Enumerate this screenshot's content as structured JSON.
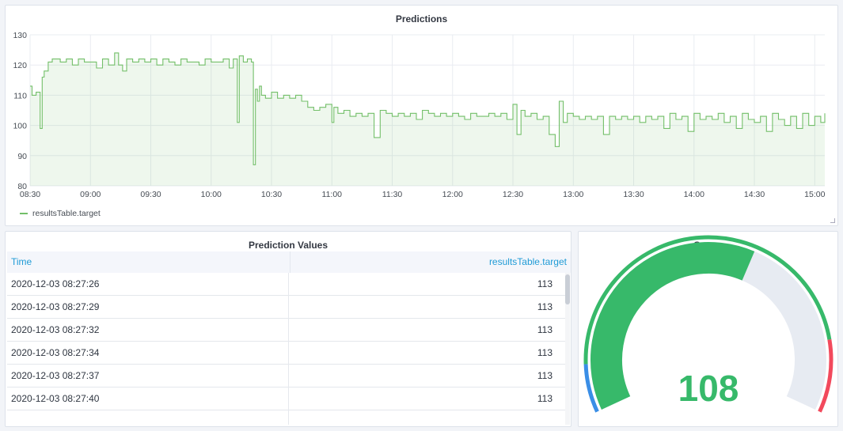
{
  "panels": {
    "predictions": {
      "title": "Predictions"
    },
    "table": {
      "title": "Prediction Values"
    },
    "gauge": {
      "title": "Gauge"
    }
  },
  "chart_data": {
    "type": "area",
    "title": "Predictions",
    "xlabel": "",
    "ylabel": "",
    "x_ticks": [
      "08:30",
      "09:00",
      "09:30",
      "10:00",
      "10:30",
      "11:00",
      "11:30",
      "12:00",
      "12:30",
      "13:00",
      "13:30",
      "14:00",
      "14:30",
      "15:00"
    ],
    "y_ticks": [
      80,
      90,
      100,
      110,
      120,
      130
    ],
    "ylim": [
      80,
      130
    ],
    "xlim": [
      "08:30",
      "15:05"
    ],
    "grid": true,
    "legend": "bottom-left",
    "series": [
      {
        "name": "resultsTable.target",
        "color": "#73bf69",
        "x": [
          "08:30",
          "08:31",
          "08:33",
          "08:35",
          "08:36",
          "08:37",
          "08:39",
          "08:41",
          "08:43",
          "08:45",
          "08:48",
          "08:51",
          "08:54",
          "08:57",
          "09:00",
          "09:03",
          "09:06",
          "09:09",
          "09:12",
          "09:14",
          "09:16",
          "09:18",
          "09:21",
          "09:24",
          "09:27",
          "09:30",
          "09:33",
          "09:36",
          "09:39",
          "09:42",
          "09:45",
          "09:48",
          "09:51",
          "09:54",
          "09:57",
          "10:00",
          "10:03",
          "10:06",
          "10:09",
          "10:11",
          "10:12",
          "10:13",
          "10:14",
          "10:16",
          "10:18",
          "10:20",
          "10:21",
          "10:22",
          "10:23",
          "10:24",
          "10:25",
          "10:27",
          "10:30",
          "10:33",
          "10:36",
          "10:39",
          "10:42",
          "10:45",
          "10:48",
          "10:51",
          "10:54",
          "10:57",
          "11:00",
          "11:01",
          "11:03",
          "11:06",
          "11:09",
          "11:12",
          "11:15",
          "11:18",
          "11:21",
          "11:24",
          "11:27",
          "11:30",
          "11:33",
          "11:36",
          "11:39",
          "11:42",
          "11:45",
          "11:48",
          "11:51",
          "11:54",
          "11:57",
          "12:00",
          "12:03",
          "12:06",
          "12:09",
          "12:12",
          "12:15",
          "12:18",
          "12:21",
          "12:24",
          "12:27",
          "12:30",
          "12:32",
          "12:34",
          "12:36",
          "12:39",
          "12:42",
          "12:45",
          "12:48",
          "12:51",
          "12:53",
          "12:55",
          "12:57",
          "13:00",
          "13:03",
          "13:06",
          "13:09",
          "13:12",
          "13:15",
          "13:18",
          "13:21",
          "13:24",
          "13:27",
          "13:30",
          "13:33",
          "13:36",
          "13:39",
          "13:42",
          "13:45",
          "13:48",
          "13:51",
          "13:54",
          "13:57",
          "14:00",
          "14:03",
          "14:06",
          "14:09",
          "14:12",
          "14:15",
          "14:18",
          "14:21",
          "14:24",
          "14:27",
          "14:30",
          "14:33",
          "14:36",
          "14:39",
          "14:42",
          "14:45",
          "14:48",
          "14:51",
          "14:54",
          "14:57",
          "15:00",
          "15:03",
          "15:05"
        ],
        "values": [
          113,
          110,
          111,
          99,
          116,
          118,
          121,
          122,
          122,
          121,
          122,
          120,
          122,
          121,
          121,
          119,
          122,
          120,
          124,
          120,
          118,
          122,
          121,
          122,
          121,
          122,
          120,
          122,
          121,
          120,
          122,
          121,
          121,
          120,
          122,
          121,
          121,
          122,
          119,
          122,
          122,
          101,
          123,
          121,
          122,
          121,
          87,
          112,
          108,
          113,
          110,
          109,
          111,
          109,
          110,
          109,
          110,
          108,
          106,
          105,
          106,
          107,
          101,
          106,
          104,
          105,
          103,
          104,
          103,
          104,
          96,
          105,
          104,
          103,
          104,
          103,
          104,
          102,
          105,
          104,
          103,
          104,
          103,
          104,
          103,
          102,
          104,
          103,
          103,
          104,
          103,
          104,
          102,
          107,
          97,
          105,
          103,
          104,
          102,
          103,
          97,
          93,
          108,
          101,
          104,
          103,
          102,
          103,
          102,
          103,
          97,
          103,
          102,
          103,
          102,
          103,
          101,
          103,
          102,
          103,
          99,
          104,
          102,
          103,
          98,
          104,
          102,
          103,
          102,
          104,
          101,
          103,
          99,
          104,
          102,
          101,
          103,
          98,
          104,
          102,
          100,
          103,
          99,
          104,
          100,
          103,
          101,
          104
        ]
      }
    ]
  },
  "table": {
    "columns": {
      "time": "Time",
      "value": "resultsTable.target"
    },
    "rows": [
      {
        "time": "2020-12-03 08:27:26",
        "value": "113"
      },
      {
        "time": "2020-12-03 08:27:29",
        "value": "113"
      },
      {
        "time": "2020-12-03 08:27:32",
        "value": "113"
      },
      {
        "time": "2020-12-03 08:27:34",
        "value": "113"
      },
      {
        "time": "2020-12-03 08:27:37",
        "value": "113"
      },
      {
        "time": "2020-12-03 08:27:40",
        "value": "113"
      }
    ]
  },
  "gauge": {
    "value": "108",
    "value_color": "#37b96a",
    "fill_fraction": 0.6,
    "colors": {
      "low": "#3a8ee6",
      "normal": "#37b96a",
      "high": "#f2495c",
      "track": "#e7ebf2"
    },
    "thresholds_fraction": [
      0,
      0.1,
      0.85,
      1
    ]
  }
}
